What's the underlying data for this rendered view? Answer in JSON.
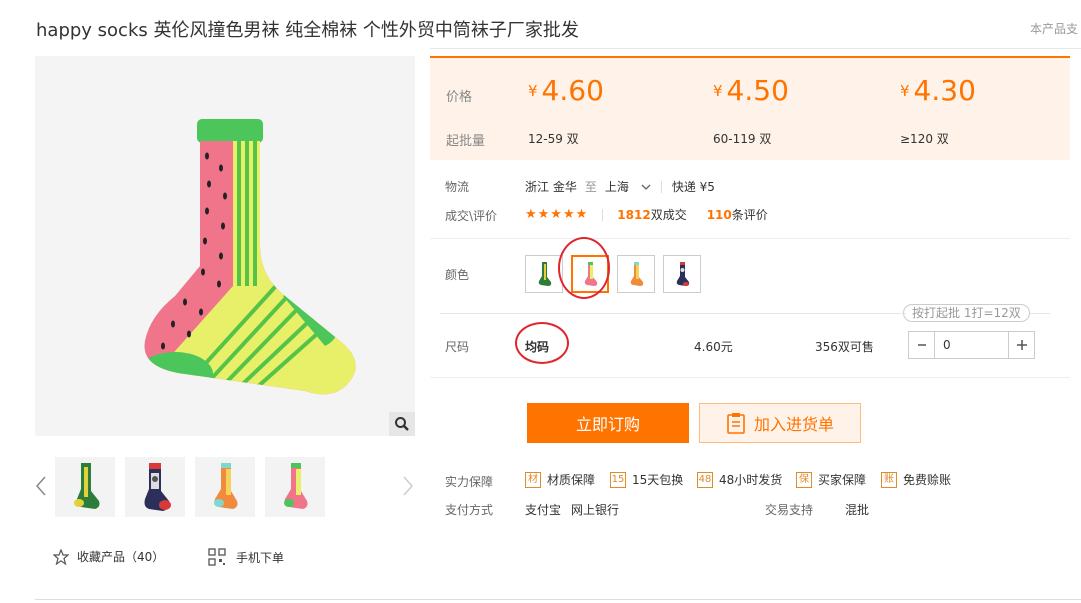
{
  "product": {
    "title": "happy socks 英伦风撞色男袜 纯全棉袜 个性外贸中筒袜子厂家批发",
    "top_note": "本产品支"
  },
  "price_panel": {
    "price_label": "价格",
    "moq_label": "起批量",
    "currency": "¥",
    "tiers": [
      {
        "price": "4.60",
        "range": "12-59 双"
      },
      {
        "price": "4.50",
        "range": "60-119 双"
      },
      {
        "price": "4.30",
        "range": "≥120 双"
      }
    ]
  },
  "logistics": {
    "label": "物流",
    "from": "浙江 金华",
    "to_word": "至",
    "to": "上海",
    "express": "快递 ¥5"
  },
  "deals": {
    "label": "成交\\评价",
    "stars": "★★★★★",
    "sales_count": "1812",
    "sales_suffix": "双成交",
    "review_count": "110",
    "review_suffix": "条评价"
  },
  "color": {
    "label": "颜色",
    "swatches": [
      "yellow-green-sock",
      "pink-green-sock",
      "orange-teal-sock",
      "navy-red-sock"
    ],
    "selected_index": 1
  },
  "batch_tip": "按打起批 1打=12双",
  "size": {
    "label": "尺码",
    "value": "均码",
    "price": "4.60元",
    "stock": "356双可售",
    "quantity": "0"
  },
  "buttons": {
    "buy": "立即订购",
    "cart": "加入进货单"
  },
  "guarantees": {
    "label": "实力保障",
    "items": [
      {
        "icon": "材",
        "label": "材质保障"
      },
      {
        "icon": "15",
        "label": "15天包换"
      },
      {
        "icon": "48",
        "label": "48小时发货"
      },
      {
        "icon": "保",
        "label": "买家保障"
      },
      {
        "icon": "账",
        "label": "免费赊账"
      }
    ]
  },
  "payment": {
    "label": "支付方式",
    "methods": [
      "支付宝",
      "网上银行"
    ],
    "trade_label": "交易支持",
    "trade_value": "混批"
  },
  "bottom_actions": {
    "favorite": "收藏产品（40）",
    "mobile": "手机下单"
  },
  "colors": {
    "accent": "#ff7300",
    "panel_bg": "#fff2e8",
    "annotation": "#e1252b",
    "sock_pink": "#f0758a",
    "sock_green": "#4cc65a",
    "sock_stripe": "#e8f06a"
  }
}
